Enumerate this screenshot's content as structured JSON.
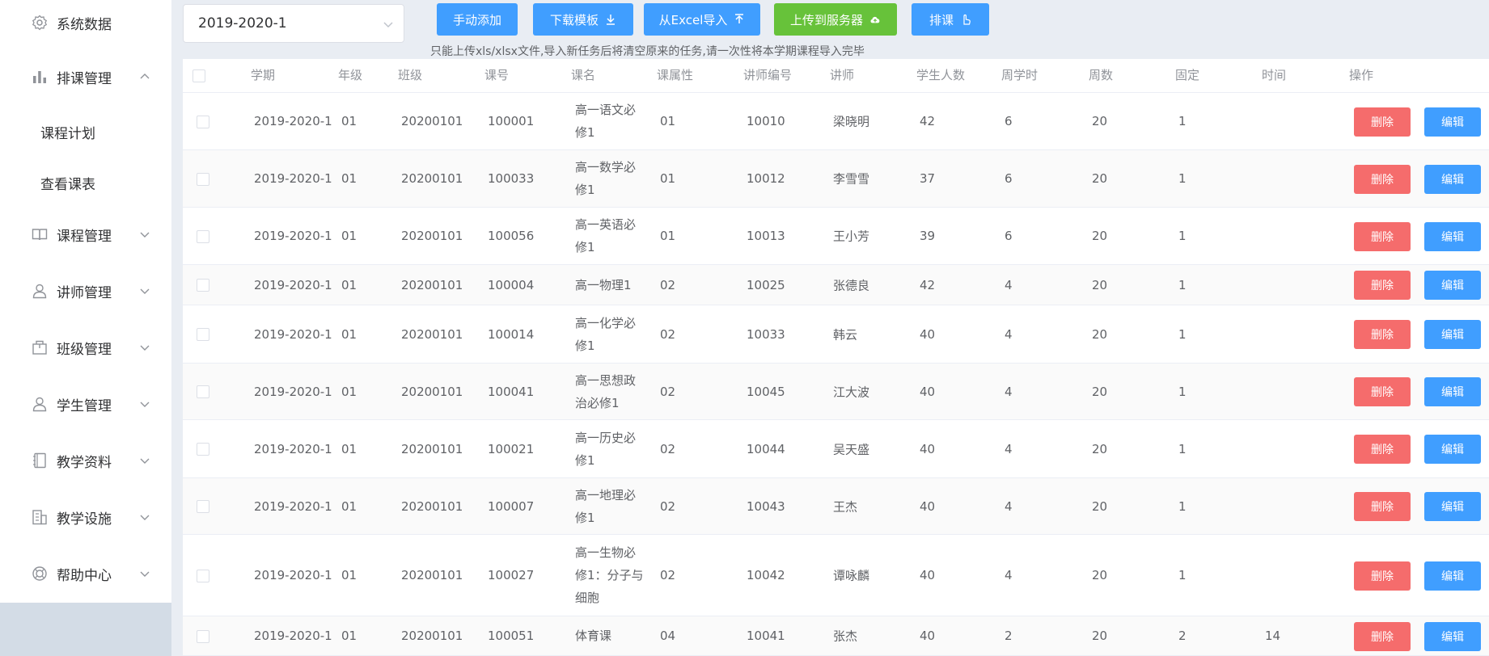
{
  "sidebar": {
    "items": [
      {
        "label": "系统数据",
        "icon": "gear-icon",
        "arrow": "none"
      },
      {
        "label": "排课管理",
        "icon": "bar-chart-icon",
        "arrow": "up"
      },
      {
        "label": "课程计划",
        "icon": "",
        "arrow": "none"
      },
      {
        "label": "查看课表",
        "icon": "",
        "arrow": "none"
      },
      {
        "label": "课程管理",
        "icon": "book-icon",
        "arrow": "down"
      },
      {
        "label": "讲师管理",
        "icon": "user-icon",
        "arrow": "down"
      },
      {
        "label": "班级管理",
        "icon": "box-icon",
        "arrow": "down"
      },
      {
        "label": "学生管理",
        "icon": "user-icon",
        "arrow": "down"
      },
      {
        "label": "教学资料",
        "icon": "notebook-icon",
        "arrow": "down"
      },
      {
        "label": "教学设施",
        "icon": "building-icon",
        "arrow": "down"
      },
      {
        "label": "帮助中心",
        "icon": "lifebuoy-icon",
        "arrow": "down"
      }
    ]
  },
  "toolbar": {
    "term_value": "2019-2020-1",
    "manual_add_label": "手动添加",
    "download_template_label": "下载模板",
    "import_excel_label": "从Excel导入",
    "upload_server_label": "上传到服务器",
    "schedule_label": "排课",
    "hint": "只能上传xls/xlsx文件,导入新任务后将清空原来的任务,请一次性将本学期课程导入完毕"
  },
  "table": {
    "headers": [
      "学期",
      "年级",
      "班级",
      "课号",
      "课名",
      "课属性",
      "讲师编号",
      "讲师",
      "学生人数",
      "周学时",
      "周数",
      "固定",
      "时间",
      "操作"
    ],
    "delete_label": "删除",
    "edit_label": "编辑",
    "rows": [
      {
        "term": "2019-2020-1",
        "grade": "01",
        "class": "20200101",
        "course_no": "100001",
        "course_name": "高一语文必修1",
        "attr": "01",
        "teacher_no": "10010",
        "teacher": "梁晓明",
        "students": "42",
        "weekly_hours": "6",
        "weeks": "20",
        "fixed": "1",
        "time": ""
      },
      {
        "term": "2019-2020-1",
        "grade": "01",
        "class": "20200101",
        "course_no": "100033",
        "course_name": "高一数学必修1",
        "attr": "01",
        "teacher_no": "10012",
        "teacher": "李雪雪",
        "students": "37",
        "weekly_hours": "6",
        "weeks": "20",
        "fixed": "1",
        "time": ""
      },
      {
        "term": "2019-2020-1",
        "grade": "01",
        "class": "20200101",
        "course_no": "100056",
        "course_name": "高一英语必修1",
        "attr": "01",
        "teacher_no": "10013",
        "teacher": "王小芳",
        "students": "39",
        "weekly_hours": "6",
        "weeks": "20",
        "fixed": "1",
        "time": ""
      },
      {
        "term": "2019-2020-1",
        "grade": "01",
        "class": "20200101",
        "course_no": "100004",
        "course_name": "高一物理1",
        "attr": "02",
        "teacher_no": "10025",
        "teacher": "张德良",
        "students": "42",
        "weekly_hours": "4",
        "weeks": "20",
        "fixed": "1",
        "time": ""
      },
      {
        "term": "2019-2020-1",
        "grade": "01",
        "class": "20200101",
        "course_no": "100014",
        "course_name": "高一化学必修1",
        "attr": "02",
        "teacher_no": "10033",
        "teacher": "韩云",
        "students": "40",
        "weekly_hours": "4",
        "weeks": "20",
        "fixed": "1",
        "time": ""
      },
      {
        "term": "2019-2020-1",
        "grade": "01",
        "class": "20200101",
        "course_no": "100041",
        "course_name": "高一思想政治必修1",
        "attr": "02",
        "teacher_no": "10045",
        "teacher": "江大波",
        "students": "40",
        "weekly_hours": "4",
        "weeks": "20",
        "fixed": "1",
        "time": ""
      },
      {
        "term": "2019-2020-1",
        "grade": "01",
        "class": "20200101",
        "course_no": "100021",
        "course_name": "高一历史必修1",
        "attr": "02",
        "teacher_no": "10044",
        "teacher": "吴天盛",
        "students": "40",
        "weekly_hours": "4",
        "weeks": "20",
        "fixed": "1",
        "time": ""
      },
      {
        "term": "2019-2020-1",
        "grade": "01",
        "class": "20200101",
        "course_no": "100007",
        "course_name": "高一地理必修1",
        "attr": "02",
        "teacher_no": "10043",
        "teacher": "王杰",
        "students": "40",
        "weekly_hours": "4",
        "weeks": "20",
        "fixed": "1",
        "time": ""
      },
      {
        "term": "2019-2020-1",
        "grade": "01",
        "class": "20200101",
        "course_no": "100027",
        "course_name": "高一生物必修1：分子与细胞",
        "attr": "02",
        "teacher_no": "10042",
        "teacher": "谭咏麟",
        "students": "40",
        "weekly_hours": "4",
        "weeks": "20",
        "fixed": "1",
        "time": ""
      },
      {
        "term": "2019-2020-1",
        "grade": "01",
        "class": "20200101",
        "course_no": "100051",
        "course_name": "体育课",
        "attr": "04",
        "teacher_no": "10041",
        "teacher": "张杰",
        "students": "40",
        "weekly_hours": "2",
        "weeks": "20",
        "fixed": "2",
        "time": "14"
      }
    ]
  },
  "colors": {
    "primary": "#409eff",
    "success": "#67c23a",
    "danger": "#f56c6c",
    "sidebar_bottom": "#d3dce6"
  }
}
